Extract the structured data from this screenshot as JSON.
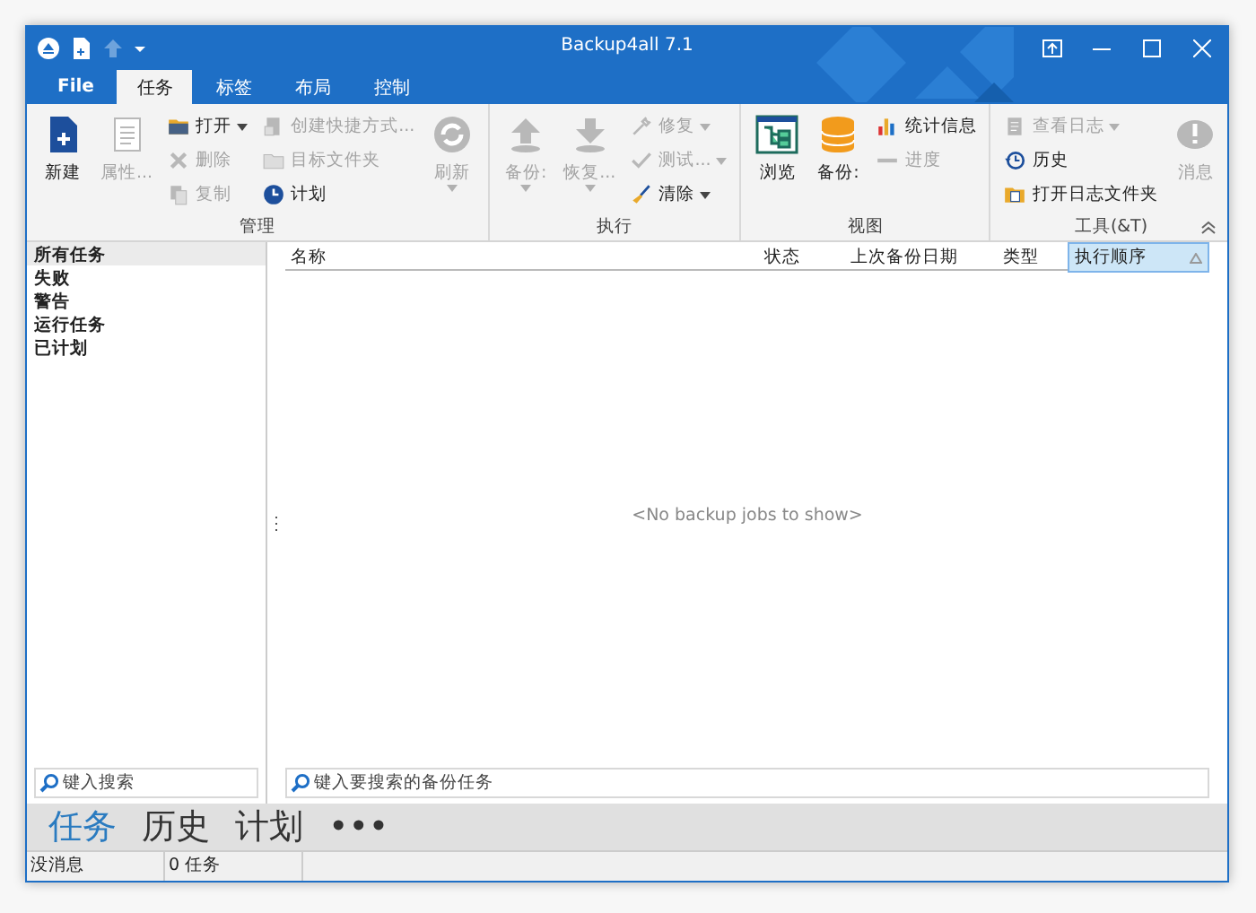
{
  "window": {
    "title": "Backup4all 7.1"
  },
  "tabs": [
    {
      "label": "File",
      "selected": false
    },
    {
      "label": "任务",
      "selected": true
    },
    {
      "label": "标签",
      "selected": false
    },
    {
      "label": "布局",
      "selected": false
    },
    {
      "label": "控制",
      "selected": false
    }
  ],
  "ribbon": {
    "groups": [
      {
        "label": "管理",
        "columns": [
          [
            {
              "kind": "large",
              "label": "新建",
              "disabled": false,
              "dropdown": false
            }
          ],
          [
            {
              "kind": "large",
              "label": "属性...",
              "disabled": true,
              "dropdown": false
            }
          ],
          [
            {
              "kind": "small",
              "label": "打开",
              "disabled": false,
              "dropdown": true
            },
            {
              "kind": "small",
              "label": "删除",
              "disabled": true,
              "dropdown": false
            },
            {
              "kind": "small",
              "label": "复制",
              "disabled": true,
              "dropdown": false
            }
          ],
          [
            {
              "kind": "small",
              "label": "创建快捷方式...",
              "disabled": true,
              "dropdown": false
            },
            {
              "kind": "small",
              "label": "目标文件夹",
              "disabled": true,
              "dropdown": false
            },
            {
              "kind": "small",
              "label": "计划",
              "disabled": false,
              "dropdown": false
            }
          ],
          [
            {
              "kind": "large",
              "label": "刷新",
              "disabled": true,
              "dropdown": true
            }
          ]
        ]
      },
      {
        "label": "执行",
        "columns": [
          [
            {
              "kind": "large",
              "label": "备份:",
              "disabled": true,
              "dropdown": true
            }
          ],
          [
            {
              "kind": "large",
              "label": "恢复...",
              "disabled": true,
              "dropdown": true
            }
          ],
          [
            {
              "kind": "small",
              "label": "修复",
              "disabled": true,
              "dropdown": true
            },
            {
              "kind": "small",
              "label": "测试...",
              "disabled": true,
              "dropdown": true
            },
            {
              "kind": "small",
              "label": "清除",
              "disabled": false,
              "dropdown": true
            }
          ]
        ]
      },
      {
        "label": "视图",
        "columns": [
          [
            {
              "kind": "large",
              "label": "浏览",
              "disabled": false,
              "dropdown": false
            }
          ],
          [
            {
              "kind": "large",
              "label": "备份:",
              "disabled": false,
              "dropdown": false
            }
          ],
          [
            {
              "kind": "small",
              "label": "统计信息",
              "disabled": false,
              "dropdown": false
            },
            {
              "kind": "small",
              "label": "进度",
              "disabled": true,
              "dropdown": false
            }
          ]
        ]
      },
      {
        "label": "工具(&T)",
        "columns": [
          [
            {
              "kind": "small",
              "label": "查看日志",
              "disabled": true,
              "dropdown": true
            },
            {
              "kind": "small",
              "label": "历史",
              "disabled": false,
              "dropdown": false
            },
            {
              "kind": "small",
              "label": "打开日志文件夹",
              "disabled": false,
              "dropdown": false
            }
          ],
          [
            {
              "kind": "large",
              "label": "消息",
              "disabled": true,
              "dropdown": false
            }
          ]
        ]
      }
    ]
  },
  "sidebar": {
    "items": [
      {
        "label": "所有任务",
        "selected": true
      },
      {
        "label": "失败",
        "selected": false
      },
      {
        "label": "警告",
        "selected": false
      },
      {
        "label": "运行任务",
        "selected": false
      },
      {
        "label": "已计划",
        "selected": false
      }
    ],
    "search": {
      "placeholder": "键入搜索"
    }
  },
  "table": {
    "columns": [
      {
        "label": "名称",
        "selected": false
      },
      {
        "label": "状态",
        "selected": false
      },
      {
        "label": "上次备份日期",
        "selected": false
      },
      {
        "label": "类型",
        "selected": false
      },
      {
        "label": "执行顺序",
        "selected": true
      }
    ],
    "empty_message": "<No backup jobs to show>",
    "search": {
      "placeholder": "键入要搜索的备份任务"
    }
  },
  "nav": [
    {
      "label": "任务",
      "selected": true
    },
    {
      "label": "历史",
      "selected": false
    },
    {
      "label": "计划",
      "selected": false
    },
    {
      "label": "•••",
      "selected": false
    }
  ],
  "status_bar": [
    "没消息",
    "0 任务"
  ]
}
